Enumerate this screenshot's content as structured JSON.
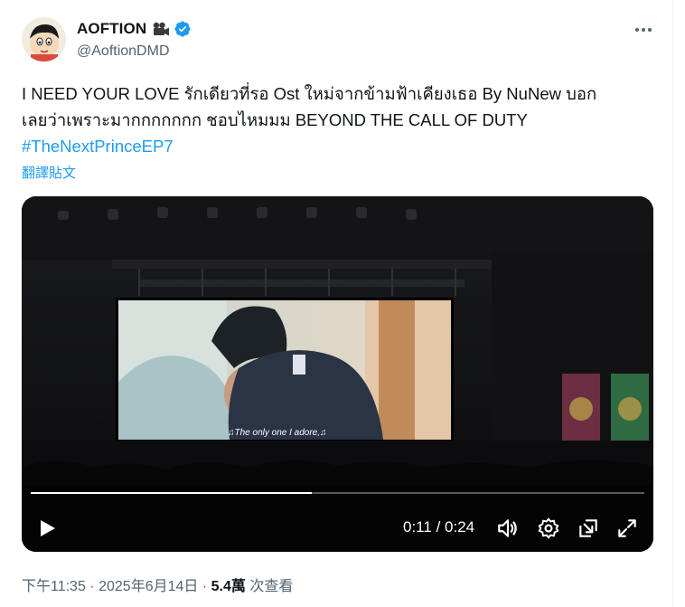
{
  "author": {
    "display_name": "AOFTION",
    "handle": "@AoftionDMD",
    "name_emoji_icon": "movie-camera-icon",
    "verified_icon": "verified-badge-icon",
    "verified_color": "#1d9bf0"
  },
  "tweet": {
    "line1": "I NEED YOUR LOVE รักเดียวที่รอ Ost ใหม่จากข้ามฟ้าเคียงเธอ By NuNew บอก",
    "line2": "เลยว่าเพราะมากกกกกกก ชอบไหมมม BEYOND THE CALL OF DUTY",
    "hashtag": "#TheNextPrinceEP7",
    "translate_label": "翻譯貼文"
  },
  "video": {
    "caption": "♫The only one I adore,♫",
    "current_time": "0:11",
    "duration": "0:24",
    "time_separator": "/",
    "progress_fraction": 0.458,
    "controls": [
      "play-icon",
      "volume-icon",
      "settings-gear-icon",
      "pop-out-icon",
      "fullscreen-icon"
    ]
  },
  "meta": {
    "time": "下午11:35",
    "separator": "·",
    "date": "2025年6月14日",
    "views_count": "5.4萬",
    "views_label": "次查看"
  },
  "colors": {
    "link": "#1d9bf0",
    "secondary_text": "#536471",
    "primary_text": "#0f1419"
  }
}
